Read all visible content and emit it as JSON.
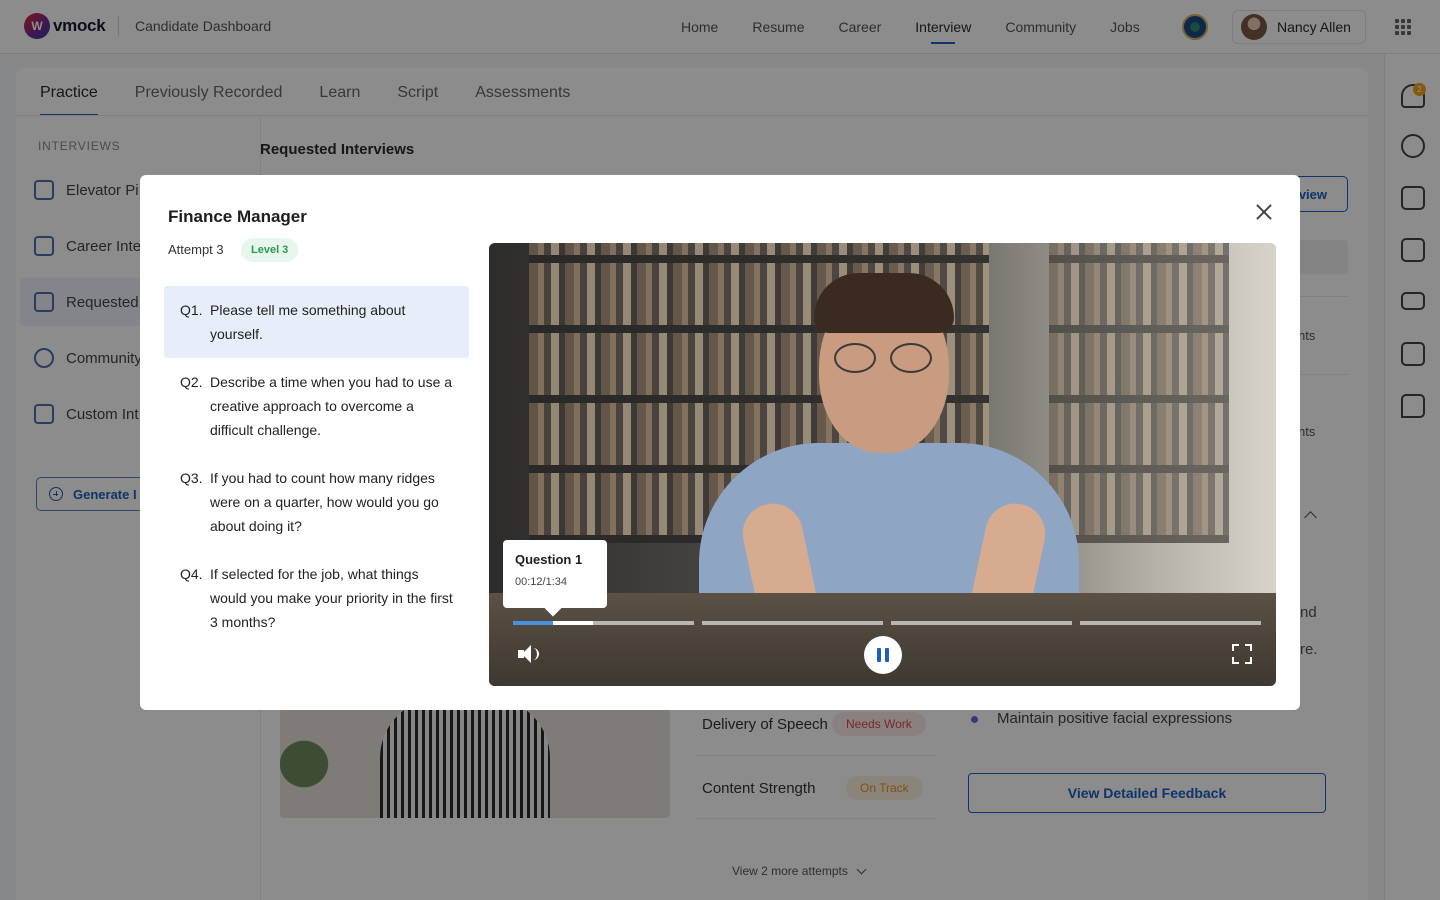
{
  "brand": {
    "logo_text": "vmock",
    "logo_mark": "W",
    "app_title": "Candidate Dashboard"
  },
  "nav": {
    "items": [
      {
        "label": "Home"
      },
      {
        "label": "Resume"
      },
      {
        "label": "Career"
      },
      {
        "label": "Interview",
        "active": true
      },
      {
        "label": "Community"
      },
      {
        "label": "Jobs"
      }
    ],
    "user_name": "Nancy Allen",
    "notification_count": "2"
  },
  "tabs": [
    {
      "label": "Practice",
      "active": true
    },
    {
      "label": "Previously Recorded"
    },
    {
      "label": "Learn"
    },
    {
      "label": "Script"
    },
    {
      "label": "Assessments"
    }
  ],
  "sidebar": {
    "heading": "INTERVIEWS",
    "items": [
      {
        "label": "Elevator Pi"
      },
      {
        "label": "Career Inte"
      },
      {
        "label": "Requested",
        "active": true
      },
      {
        "label": "Community"
      },
      {
        "label": "Custom Int"
      }
    ],
    "generate_button": "Generate I"
  },
  "main": {
    "section_title": "Requested Interviews",
    "view_button_fragment": "view",
    "fragments": [
      "nts",
      "nts",
      "nd",
      "re."
    ],
    "metrics": [
      {
        "label": "Delivery of Speech",
        "status": "Needs Work"
      },
      {
        "label": "Content Strength",
        "status": "On Track"
      }
    ],
    "tip": "Maintain positive facial expressions",
    "feedback_button": "View Detailed Feedback",
    "more_attempts": "View 2 more attempts"
  },
  "modal": {
    "title": "Finance Manager",
    "attempt": "Attempt 3",
    "level": "Level 3",
    "questions": [
      {
        "num": "Q1.",
        "text": "Please tell me something about yourself.",
        "active": true
      },
      {
        "num": "Q2.",
        "text": "Describe a time when you had to use a creative approach to overcome a difficult challenge."
      },
      {
        "num": "Q3.",
        "text": "If you had to count how many ridges were on a quarter, how would you go about doing it?"
      },
      {
        "num": "Q4.",
        "text": "If selected for the job, what things would you make your priority in the first 3 months?"
      }
    ],
    "player": {
      "tooltip_title": "Question 1",
      "tooltip_time": "00:12/1:34",
      "current_question_progress": 0.22,
      "current_question_buffered": 0.44,
      "segments": 4
    }
  },
  "colors": {
    "accent": "#1e5fbf",
    "progress": "#4a90e2",
    "level_bg": "#e7f6ec",
    "level_text": "#2a9a51",
    "needs_work": "#d94a55",
    "on_track": "#e4962b"
  },
  "icons": {
    "rail": [
      "bell-icon",
      "check-circle-icon",
      "notes-icon",
      "calendar-icon",
      "mail-icon",
      "contact-icon",
      "chat-thumb-icon"
    ],
    "player": [
      "volume-icon",
      "pause-icon",
      "fullscreen-icon"
    ],
    "modal": [
      "close-icon"
    ]
  }
}
